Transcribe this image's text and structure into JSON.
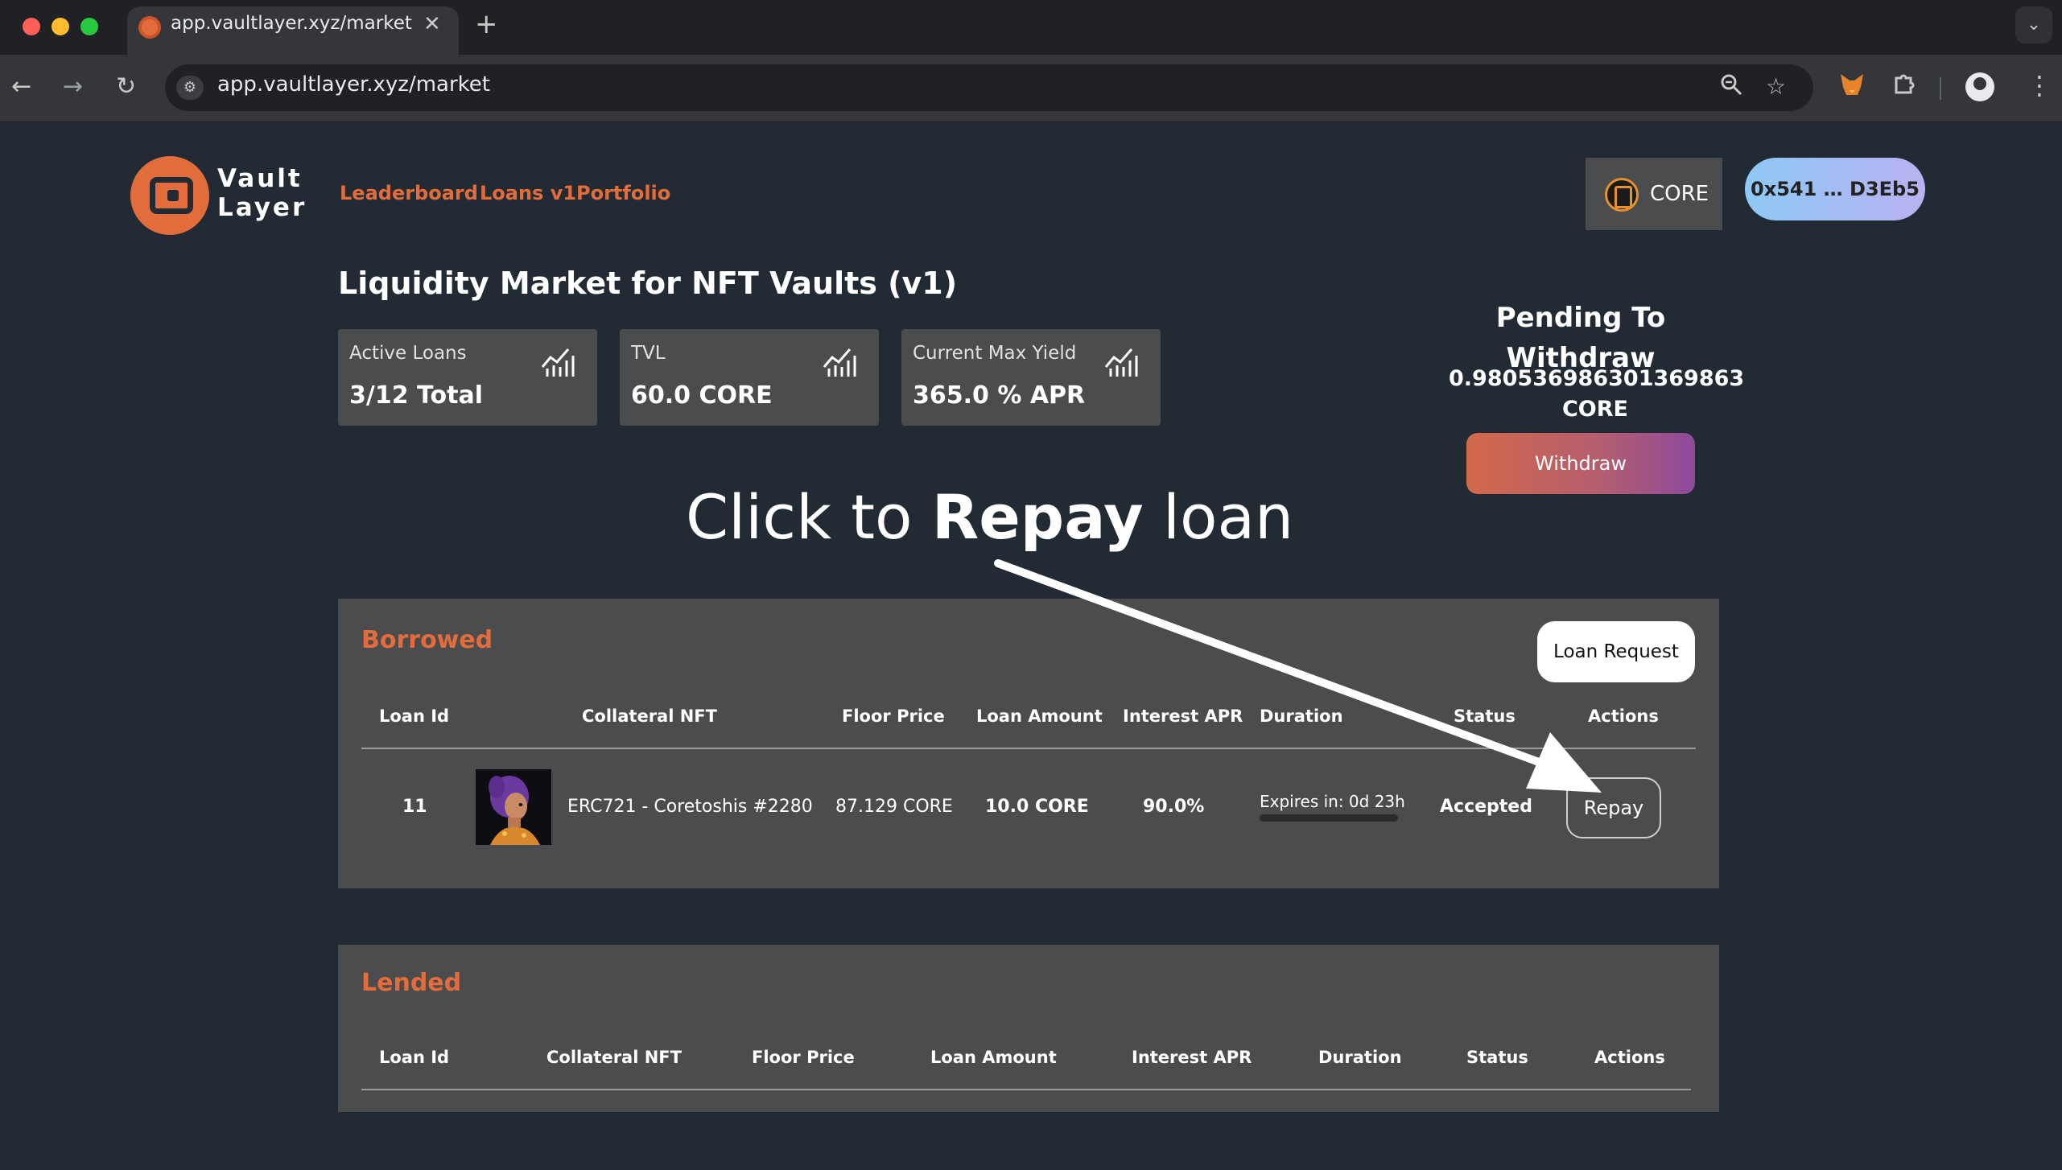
{
  "browser": {
    "tab_title": "app.vaultlayer.xyz/market",
    "tab_close": "✕",
    "new_tab": "+",
    "url": "app.vaultlayer.xyz/market"
  },
  "header": {
    "logo_line1": "Vault",
    "logo_line2": "Layer",
    "nav": [
      "Leaderboard",
      "Loans v1",
      "Portfolio"
    ],
    "chain_label": "CORE",
    "wallet": "0x541 … D3Eb5"
  },
  "page": {
    "title": "Liquidity Market for NFT Vaults (v1)"
  },
  "stats": [
    {
      "label": "Active Loans",
      "value": "3/12 Total"
    },
    {
      "label": "TVL",
      "value": "60.0 CORE"
    },
    {
      "label": "Current Max Yield",
      "value": "365.0 % APR"
    }
  ],
  "pending": {
    "title": "Pending To Withdraw",
    "amount": "0.980536986301369863",
    "unit": "CORE",
    "withdraw_label": "Withdraw"
  },
  "annotation": {
    "prefix": "Click to ",
    "bold": "Repay",
    "suffix": " loan"
  },
  "borrowed": {
    "title": "Borrowed",
    "loan_request_label": "Loan Request",
    "columns": [
      "Loan Id",
      "Collateral NFT",
      "Floor Price",
      "Loan Amount",
      "Interest APR",
      "Duration",
      "Status",
      "Actions"
    ],
    "rows": [
      {
        "loan_id": "11",
        "nft": "ERC721 - Coretoshis #2280",
        "floor_price": "87.129 CORE",
        "loan_amount": "10.0 CORE",
        "interest_apr": "90.0%",
        "duration": "Expires in: 0d 23h",
        "status": "Accepted",
        "action": "Repay"
      }
    ]
  },
  "lended": {
    "title": "Lended",
    "columns": [
      "Loan Id",
      "Collateral NFT",
      "Floor Price",
      "Loan Amount",
      "Interest APR",
      "Duration",
      "Status",
      "Actions"
    ]
  },
  "colors": {
    "background": "#222b33",
    "accent": "#e36c3c",
    "panel": "#4b4c4d",
    "wallet_gradient": [
      "#8ec8f5",
      "#b9b1f0"
    ],
    "withdraw_gradient": [
      "#d4694a",
      "#8d4a9c"
    ]
  },
  "icons": [
    "close-traffic-icon",
    "minimize-traffic-icon",
    "maximize-traffic-icon",
    "back-arrow-icon",
    "forward-arrow-icon",
    "reload-icon",
    "site-info-icon",
    "zoom-icon",
    "bookmark-star-icon",
    "metamask-fox-icon",
    "extensions-puzzle-icon",
    "profile-icon",
    "more-menu-icon",
    "chart-icon",
    "core-chain-icon",
    "arrow-annotation"
  ]
}
